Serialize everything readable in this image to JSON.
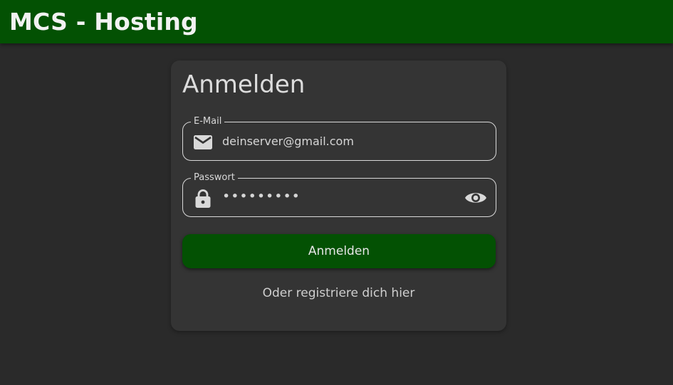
{
  "header": {
    "brand": "MCS - Hosting",
    "color": "#035103"
  },
  "login": {
    "title": "Anmelden",
    "email": {
      "label": "E-Mail",
      "value": "deinserver@gmail.com",
      "icon": "mail-icon"
    },
    "password": {
      "label": "Passwort",
      "masked_value": "•••••••••",
      "icon": "lock-icon",
      "toggle_icon": "eye-icon"
    },
    "submit_label": "Anmelden",
    "register_link": "Oder registriere dich hier"
  },
  "colors": {
    "accent": "#035103",
    "background": "#2a2a2a",
    "card": "#343434"
  }
}
